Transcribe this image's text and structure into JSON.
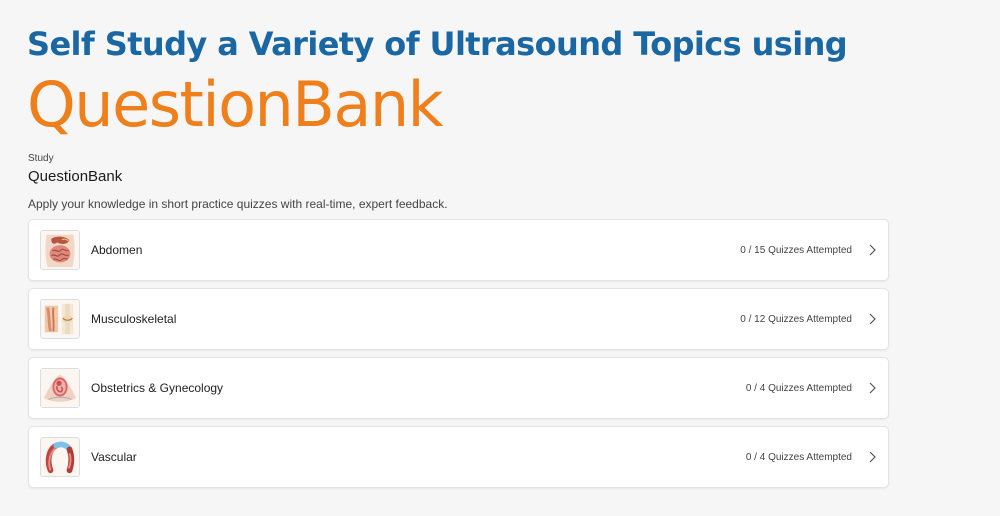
{
  "hero": {
    "title": "Self Study a Variety of Ultrasound Topics using",
    "brand": "QuestionBank"
  },
  "section": {
    "eyebrow": "Study",
    "title": "QuestionBank",
    "description": "Apply your knowledge in short practice quizzes with real-time, expert feedback."
  },
  "colors": {
    "title_blue": "#1b67a4",
    "brand_orange": "#ef7f1a",
    "background": "#f6f6f6",
    "card": "#ffffff"
  },
  "topics": [
    {
      "label": "Abdomen",
      "progress": "0 / 15 Quizzes Attempted",
      "icon": "abdomen-anatomy-icon"
    },
    {
      "label": "Musculoskeletal",
      "progress": "0 / 12 Quizzes Attempted",
      "icon": "musculoskeletal-anatomy-icon"
    },
    {
      "label": "Obstetrics & Gynecology",
      "progress": "0 / 4 Quizzes Attempted",
      "icon": "obstetrics-anatomy-icon"
    },
    {
      "label": "Vascular",
      "progress": "0 / 4 Quizzes Attempted",
      "icon": "vascular-anatomy-icon"
    }
  ]
}
